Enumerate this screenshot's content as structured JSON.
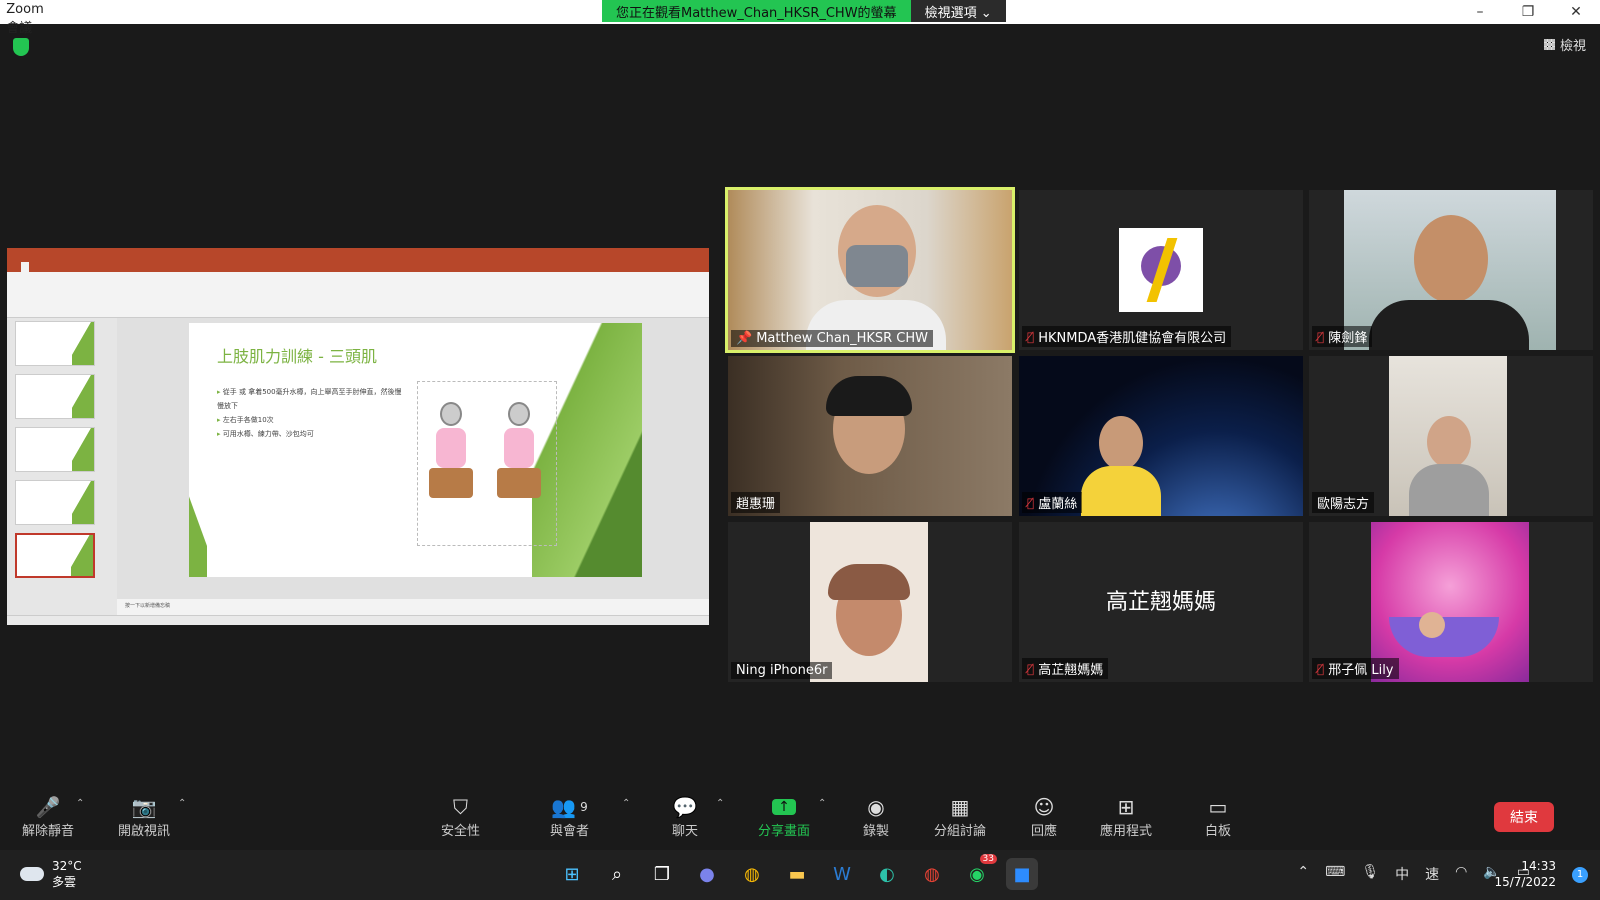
{
  "window": {
    "title": "Zoom 會議"
  },
  "banner": {
    "message": "您正在觀看Matthew_Chan_HKSR_CHW的螢幕",
    "view_options": "檢視選項 ⌄"
  },
  "view_button": "檢視",
  "slide": {
    "title": "上肢肌力訓練 - 三頭肌",
    "bullets": [
      "從手 或 拿着500毫升水樽，向上舉高至手肘伸直，然後慢慢放下",
      "左右手各做10次",
      "可用水樽、練力帶、沙包均可"
    ],
    "notes": "按一下以新增備忘稿"
  },
  "participants": [
    {
      "name": "Matthew Chan_HKSR CHW",
      "muted": false,
      "active": true
    },
    {
      "name": "HKNMDA香港肌健協會有限公司",
      "muted": true
    },
    {
      "name": "陳劍鋒",
      "muted": true
    },
    {
      "name": "趙惠珊",
      "muted": false
    },
    {
      "name": "盧蘭絲",
      "muted": true
    },
    {
      "name": "歐陽志方",
      "muted": false
    },
    {
      "name": "Ning iPhone6r",
      "muted": false
    },
    {
      "name": "高芷翹媽媽",
      "muted": true,
      "display_text": "高芷翹媽媽"
    },
    {
      "name": "邢子佩 Lily",
      "muted": true
    }
  ],
  "toolbar": {
    "unmute": "解除靜音",
    "start_video": "開啟視訊",
    "security": "安全性",
    "participants": "與會者",
    "participants_count": "9",
    "chat": "聊天",
    "share": "分享畫面",
    "record": "錄製",
    "breakout": "分組討論",
    "reactions": "回應",
    "apps": "應用程式",
    "whiteboard": "白板",
    "end": "結束"
  },
  "taskbar": {
    "temperature": "32°C",
    "weather": "多雲",
    "badge_count": "33",
    "ime_lang": "中",
    "ime_mode": "速",
    "time": "14:33",
    "date": "15/7/2022",
    "notifications": "1"
  },
  "colors": {
    "accent_green": "#23c552",
    "end_red": "#e0393e",
    "active_border": "#d9f06a"
  }
}
